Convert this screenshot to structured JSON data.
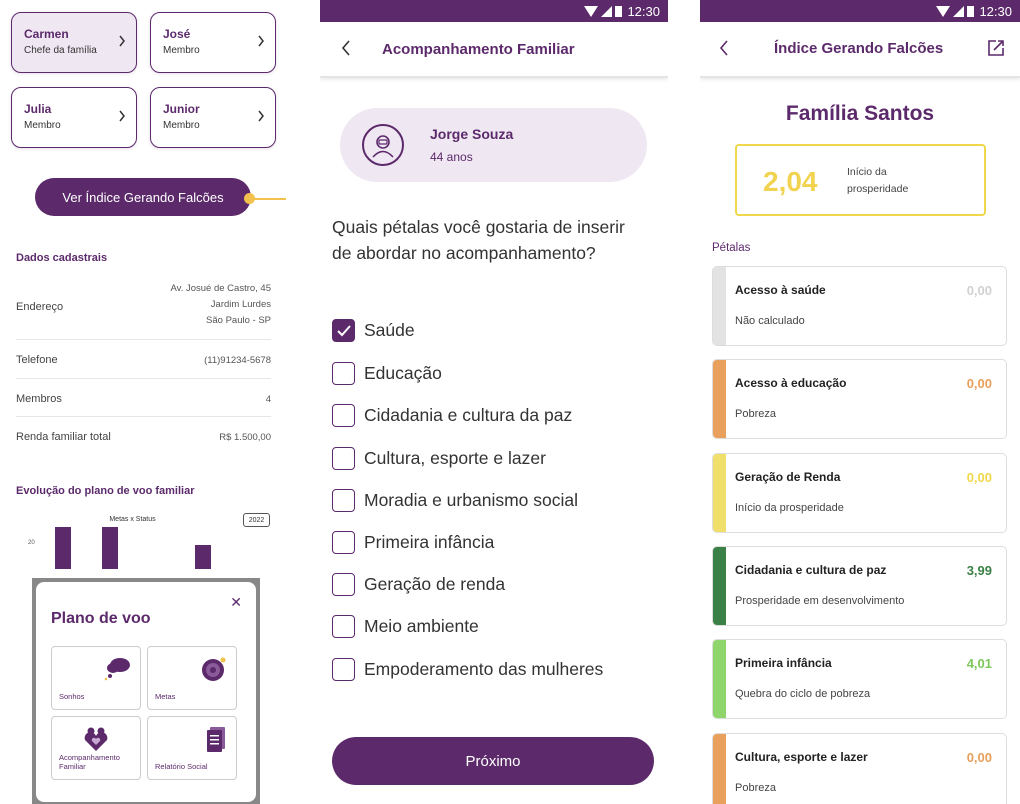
{
  "colors": {
    "primary": "#5c2a6b",
    "accent_yellow": "#f2c14e",
    "grey_strip": "#e3e3e3",
    "orange": "#e8a05c",
    "yellow": "#f0df6a",
    "dark_green": "#3b8046",
    "light_green": "#8ed66b"
  },
  "panel1": {
    "members": [
      {
        "name": "Carmen",
        "role": "Chefe da família",
        "selected": true
      },
      {
        "name": "José",
        "role": "Membro"
      },
      {
        "name": "Julia",
        "role": "Membro"
      },
      {
        "name": "Junior",
        "role": "Membro"
      }
    ],
    "ver_indice_label": "Ver Índice Gerando Falcões",
    "dados_title": "Dados cadastrais",
    "endereco": {
      "label": "Endereço",
      "line1": "Av. Josué de Castro, 45",
      "line2": "Jardim Lurdes",
      "line3": "São Paulo - SP"
    },
    "telefone": {
      "label": "Telefone",
      "value": "(11)91234-5678"
    },
    "membros": {
      "label": "Membros",
      "value": "4"
    },
    "renda": {
      "label": "Renda familiar total",
      "value": "R$ 1.500,00"
    },
    "evolucao_title": "Evolução do plano de voo familiar",
    "chart_title": "Metas x Status",
    "chart_year": "2022",
    "chart_tick": "20",
    "chart_bars": [
      30,
      30,
      17
    ],
    "sheet": {
      "title": "Plano de voo",
      "tiles": [
        {
          "label": "Sonhos",
          "icon": "cloud-dream-icon"
        },
        {
          "label": "Metas",
          "icon": "target-icon"
        },
        {
          "label": "Acompanhamento Familiar",
          "icon": "family-heart-icon"
        },
        {
          "label": "Relatório Social",
          "icon": "document-icon"
        }
      ]
    }
  },
  "panel2": {
    "status_time": "12:30",
    "title": "Acompanhamento Familiar",
    "profile_name": "Jorge Souza",
    "profile_age": "44 anos",
    "question": "Quais pétalas você gostaria de inserir de abordar no acompanhamento?",
    "options": [
      {
        "label": "Saúde",
        "checked": true
      },
      {
        "label": "Educação",
        "checked": false
      },
      {
        "label": "Cidadania e cultura da paz",
        "checked": false
      },
      {
        "label": "Cultura, esporte e lazer",
        "checked": false
      },
      {
        "label": "Moradia e urbanismo social",
        "checked": false
      },
      {
        "label": "Primeira infância",
        "checked": false
      },
      {
        "label": "Geração de renda",
        "checked": false
      },
      {
        "label": "Meio ambiente",
        "checked": false
      },
      {
        "label": "Empoderamento das mulheres",
        "checked": false
      }
    ],
    "next_label": "Próximo"
  },
  "panel3": {
    "status_time": "12:30",
    "title": "Índice Gerando Falcões",
    "family_name": "Família Santos",
    "index_value": "2,04",
    "index_label": "Início da prosperidade",
    "petalas_label": "Pétalas",
    "petals": [
      {
        "title": "Acesso à saúde",
        "value": "0,00",
        "status": "Não calculado",
        "strip": "#e3e3e3",
        "value_color": "#d0d0d0"
      },
      {
        "title": "Acesso à educação",
        "value": "0,00",
        "status": "Pobreza",
        "strip": "#e8a05c",
        "value_color": "#e8a05c"
      },
      {
        "title": "Geração de Renda",
        "value": "0,00",
        "status": "Início da prosperidade",
        "strip": "#f0df6a",
        "value_color": "#f0d84a"
      },
      {
        "title": "Cidadania e cultura de paz",
        "value": "3,99",
        "status": "Prosperidade em desenvolvimento",
        "strip": "#3b8046",
        "value_color": "#3b8046"
      },
      {
        "title": "Primeira infância",
        "value": "4,01",
        "status": "Quebra do ciclo de pobreza",
        "strip": "#8ed66b",
        "value_color": "#7cc85a"
      },
      {
        "title": "Cultura, esporte e lazer",
        "value": "0,00",
        "status": "Pobreza",
        "strip": "#e8a05c",
        "value_color": "#e8a05c"
      }
    ]
  }
}
